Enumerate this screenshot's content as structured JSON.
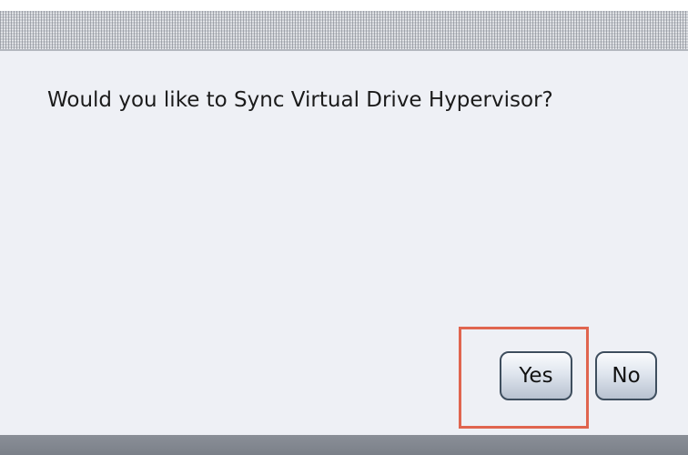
{
  "dialog": {
    "message": "Would you like to Sync Virtual Drive Hypervisor?",
    "buttons": {
      "yes_label": "Yes",
      "no_label": "No"
    }
  },
  "highlight": {
    "target": "yes-button",
    "color": "#e0654f"
  }
}
